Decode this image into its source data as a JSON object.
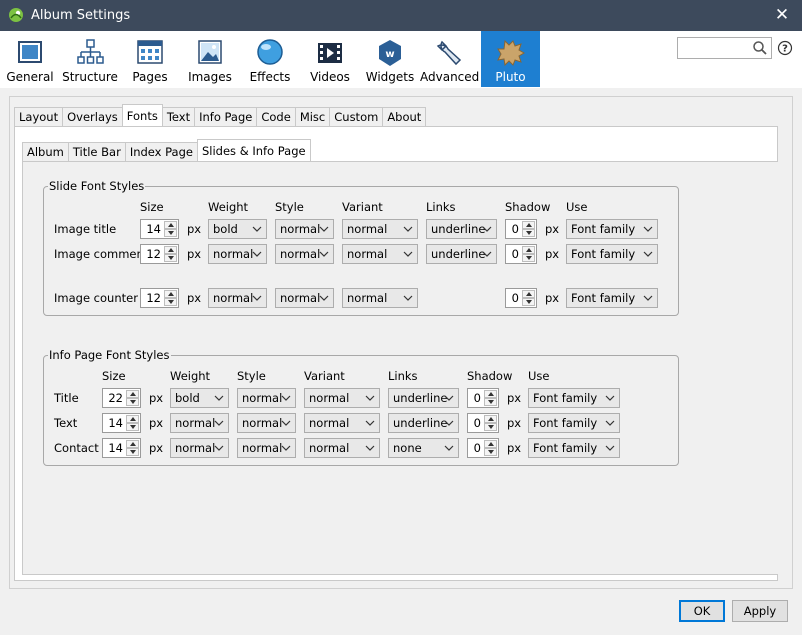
{
  "window": {
    "title": "Album Settings",
    "close_glyph": "✕"
  },
  "toolbar": {
    "items": [
      {
        "label": "General",
        "icon": "general-icon"
      },
      {
        "label": "Structure",
        "icon": "structure-icon"
      },
      {
        "label": "Pages",
        "icon": "pages-icon"
      },
      {
        "label": "Images",
        "icon": "images-icon"
      },
      {
        "label": "Effects",
        "icon": "effects-icon"
      },
      {
        "label": "Videos",
        "icon": "videos-icon"
      },
      {
        "label": "Widgets",
        "icon": "widgets-icon"
      },
      {
        "label": "Advanced",
        "icon": "advanced-icon"
      },
      {
        "label": "Pluto",
        "icon": "pluto-icon",
        "active": true
      }
    ],
    "search": {
      "value": "",
      "placeholder": ""
    },
    "active_color": "#1e7fd1"
  },
  "tabs": {
    "main": [
      "Layout",
      "Overlays",
      "Fonts",
      "Text",
      "Info Page",
      "Code",
      "Misc",
      "Custom",
      "About"
    ],
    "main_active": "Fonts",
    "sub": [
      "Album",
      "Title Bar",
      "Index Page",
      "Slides & Info Page"
    ],
    "sub_active": "Slides & Info Page"
  },
  "slide_fonts": {
    "title": "Slide Font Styles",
    "headers": {
      "size": "Size",
      "weight": "Weight",
      "style": "Style",
      "variant": "Variant",
      "links": "Links",
      "shadow": "Shadow",
      "use": "Use"
    },
    "unit": "px",
    "rows": [
      {
        "label": "Image title",
        "size": "14",
        "weight": "bold",
        "style": "normal",
        "variant": "normal",
        "links": "underline",
        "shadow": "0",
        "use": "Font family"
      },
      {
        "label": "Image comment",
        "size": "12",
        "weight": "normal",
        "style": "normal",
        "variant": "normal",
        "links": "underline",
        "shadow": "0",
        "use": "Font family"
      },
      {
        "label": "Image counter",
        "size": "12",
        "weight": "normal",
        "style": "normal",
        "variant": "normal",
        "shadow": "0",
        "use": "Font family"
      }
    ]
  },
  "info_fonts": {
    "title": "Info Page Font Styles",
    "headers": {
      "size": "Size",
      "weight": "Weight",
      "style": "Style",
      "variant": "Variant",
      "links": "Links",
      "shadow": "Shadow",
      "use": "Use"
    },
    "unit": "px",
    "rows": [
      {
        "label": "Title",
        "size": "22",
        "weight": "bold",
        "style": "normal",
        "variant": "normal",
        "links": "underline",
        "shadow": "0",
        "use": "Font family"
      },
      {
        "label": "Text",
        "size": "14",
        "weight": "normal",
        "style": "normal",
        "variant": "normal",
        "links": "underline",
        "shadow": "0",
        "use": "Font family"
      },
      {
        "label": "Contact",
        "size": "14",
        "weight": "normal",
        "style": "normal",
        "variant": "normal",
        "links": "none",
        "shadow": "0",
        "use": "Font family"
      }
    ]
  },
  "buttons": {
    "ok": "OK",
    "apply": "Apply"
  }
}
